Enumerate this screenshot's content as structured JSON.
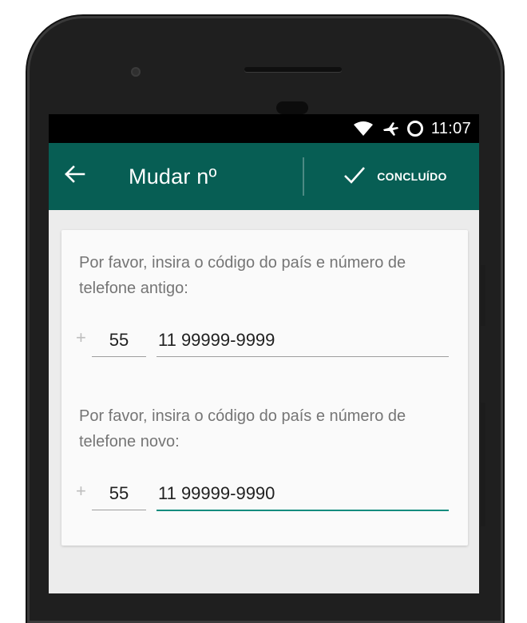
{
  "status": {
    "time": "11:07",
    "icons": [
      "wifi-icon",
      "airplane-mode-icon",
      "sync-ring-icon"
    ]
  },
  "appbar": {
    "title": "Mudar nº",
    "done_label": "CONCLUÍDO",
    "color": "#075e54"
  },
  "form": {
    "old": {
      "prompt": "Por favor, insira o código do país e número de telefone antigo:",
      "plus": "+",
      "country_code": "55",
      "number": "11 99999-9999"
    },
    "new": {
      "prompt": "Por favor, insira o código do país e número de telefone novo:",
      "plus": "+",
      "country_code": "55",
      "number": "11 99999-9990"
    },
    "focus_color": "#128c7e"
  }
}
